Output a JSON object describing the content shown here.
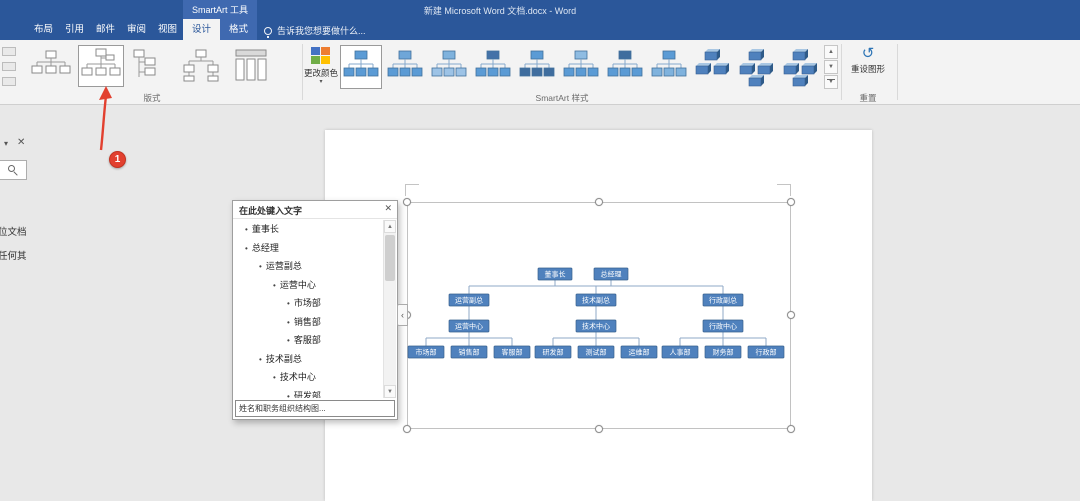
{
  "icons": {
    "close": "✕",
    "dropdown": "▾",
    "bullet": "•",
    "scroll_up": "▲",
    "scroll_down": "▼",
    "gallery_up": "▲",
    "gallery_down": "▼",
    "gallery_more": "▼",
    "pane_toggle": "‹",
    "reset": "↺",
    "nav_dropdown": "▾",
    "nav_close": "✕"
  },
  "titlebar": {
    "contextual_group_label": "SmartArt 工具",
    "window_title": "新建 Microsoft Word 文档.docx - Word",
    "main_tabs": [
      "布局",
      "引用",
      "邮件",
      "审阅",
      "视图"
    ],
    "contextual_tabs": [
      {
        "label": "设计",
        "selected": true
      },
      {
        "label": "格式",
        "selected": false
      }
    ],
    "tell_me": "告诉我您想要做什么..."
  },
  "ribbon": {
    "layouts_group": {
      "label": "版式",
      "count": 5,
      "selected_index": 1
    },
    "styles_group": {
      "label": "SmartArt 样式",
      "count": 11,
      "selected_index": 0,
      "change_colors_label": "更改颜色"
    },
    "reset_group": {
      "label": "重置",
      "button_label": "重设图形"
    }
  },
  "annotation": {
    "step_number": "1"
  },
  "nav_fragments": {
    "doc_text_1": "位文档",
    "doc_text_2": "任何其"
  },
  "text_pane": {
    "title": "在此处键入文字",
    "items": [
      {
        "label": "董事长",
        "level": 0
      },
      {
        "label": "总经理",
        "level": 0
      },
      {
        "label": "运营副总",
        "level": 1
      },
      {
        "label": "运营中心",
        "level": 2
      },
      {
        "label": "市场部",
        "level": 3
      },
      {
        "label": "销售部",
        "level": 3
      },
      {
        "label": "客服部",
        "level": 3
      },
      {
        "label": "技术副总",
        "level": 1
      },
      {
        "label": "技术中心",
        "level": 2
      },
      {
        "label": "研发部",
        "level": 3
      }
    ],
    "footer": "姓名和职务组织结构图..."
  },
  "chart_data": {
    "type": "org-chart",
    "top": [
      "董事长",
      "总经理"
    ],
    "branches": [
      {
        "vp": "运营副总",
        "center": "运营中心",
        "departments": [
          "市场部",
          "销售部",
          "客服部"
        ]
      },
      {
        "vp": "技术副总",
        "center": "技术中心",
        "departments": [
          "研发部",
          "测试部",
          "运维部"
        ]
      },
      {
        "vp": "行政副总",
        "center": "行政中心",
        "departments": [
          "人事部",
          "财务部",
          "行政部"
        ]
      }
    ]
  },
  "colors": {
    "titlebar": "#2b579a",
    "contextual_bg": "#3f69b0",
    "ribbon_bg": "#f3f3f3",
    "node_fill": "#4f81bd",
    "node_border": "#39618e",
    "connector": "#8fa9c7",
    "annotation_red": "#e2402f",
    "canvas_bg": "#e8e8e8"
  }
}
